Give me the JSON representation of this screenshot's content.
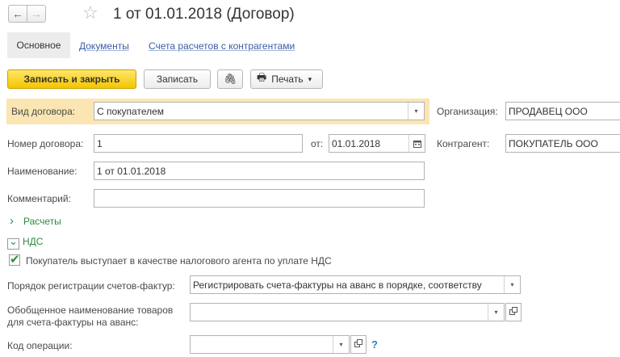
{
  "window": {
    "title": "1 от 01.01.2018 (Договор)"
  },
  "nav": {
    "back_glyph": "←",
    "forward_glyph": "→",
    "favorite_glyph": "☆"
  },
  "tabs": {
    "main": "Основное",
    "documents": "Документы",
    "accounts": "Счета расчетов с контрагентами"
  },
  "toolbar": {
    "save_close": "Записать и закрыть",
    "save": "Записать",
    "attach_glyph": "🖇",
    "print": "Печать",
    "print_glyph": "🖶",
    "dropdown_glyph": "▾"
  },
  "form": {
    "contract_type_label": "Вид договора:",
    "contract_type_value": "С покупателем",
    "org_label": "Организация:",
    "org_value": "ПРОДАВЕЦ ООО",
    "number_label": "Номер договора:",
    "number_value": "1",
    "from_label": "от:",
    "date_value": "01.01.2018",
    "counterparty_label": "Контрагент:",
    "counterparty_value": "ПОКУПАТЕЛЬ ООО",
    "name_label": "Наименование:",
    "name_value": "1 от 01.01.2018",
    "comment_label": "Комментарий:",
    "comment_value": ""
  },
  "groups": {
    "settlements": "Расчеты",
    "settlements_glyph": "›",
    "vat": "НДС",
    "vat_glyph": "⌄"
  },
  "vat": {
    "tax_agent_label": "Покупатель выступает в качестве налогового агента по уплате НДС",
    "tax_agent_checked": true,
    "invoice_order_label": "Порядок регистрации счетов-фактур:",
    "invoice_order_value": "Регистрировать счета-фактуры на аванс в порядке, соответству",
    "goods_name_label_1": "Обобщенное наименование товаров",
    "goods_name_label_2": "для счета-фактуры на аванс:",
    "goods_name_value": "",
    "operation_code_label": "Код операции:",
    "operation_code_value": "",
    "help_glyph": "?"
  }
}
